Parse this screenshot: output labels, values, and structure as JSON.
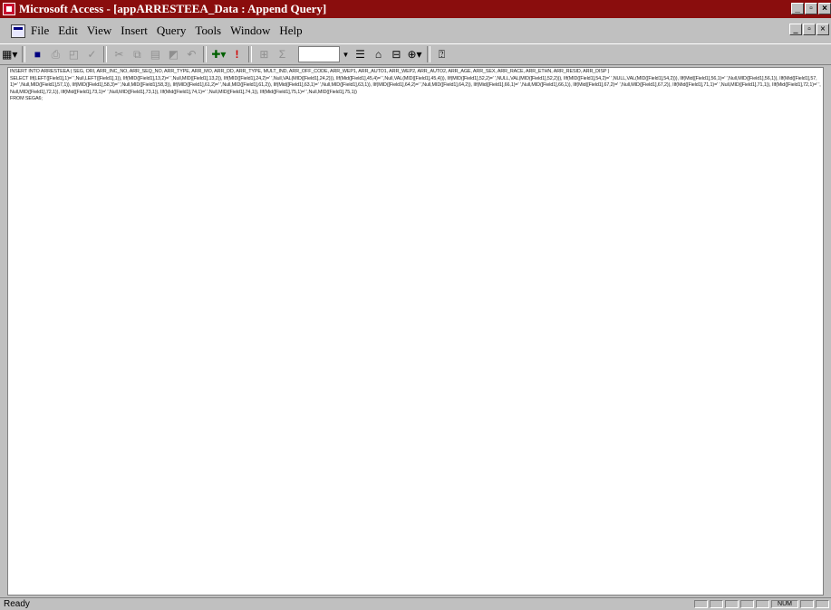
{
  "window": {
    "title": "Microsoft Access - [appARRESTEEA_Data : Append Query]"
  },
  "menu": {
    "items": [
      "File",
      "Edit",
      "View",
      "Insert",
      "Query",
      "Tools",
      "Window",
      "Help"
    ]
  },
  "toolbar": {
    "buttons": [
      {
        "name": "view-icon",
        "glyph": "▦▾"
      },
      {
        "name": "save-icon",
        "glyph": "■"
      },
      {
        "name": "print-icon",
        "glyph": "⎙"
      },
      {
        "name": "print-preview-icon",
        "glyph": "🔍"
      },
      {
        "name": "spelling-icon",
        "glyph": "✓"
      },
      {
        "name": "cut-icon",
        "glyph": "✂"
      },
      {
        "name": "copy-icon",
        "glyph": "⧉"
      },
      {
        "name": "paste-icon",
        "glyph": "📋"
      },
      {
        "name": "format-painter-icon",
        "glyph": "🖌"
      },
      {
        "name": "undo-icon",
        "glyph": "↶"
      },
      {
        "name": "query-type-icon",
        "glyph": "✚▾"
      },
      {
        "name": "run-icon",
        "glyph": "!"
      },
      {
        "name": "show-table-icon",
        "glyph": "⊞"
      },
      {
        "name": "totals-icon",
        "glyph": "Σ"
      },
      {
        "name": "properties-icon",
        "glyph": "☰"
      },
      {
        "name": "build-icon",
        "glyph": "⌂"
      },
      {
        "name": "database-window-icon",
        "glyph": "⊟"
      },
      {
        "name": "new-object-icon",
        "glyph": "⊕▾"
      },
      {
        "name": "help-icon",
        "glyph": "?"
      }
    ]
  },
  "query_text": "INSERT INTO ARRESTEEA ( SEG, ORI, ARR_INC_NO, ARR_SEQ_NO, ARR_TYPE, ARR_MO, ARR_DD, ARR_TYPE, MULT_IND, ARR_OFF_CODE, ARR_WEP1, ARR_AUTO1, ARR_WEP2, ARR_AUTO2, ARR_AGE, ARR_SEX, ARR_RACE, ARR_ETHN, ARR_RESID, ARR_DISP )\nSELECT IIf(LEFT([Field1],1)=' ',Null,LEFT([Field1],1)), IIf(MID([Field1],13,2)=' ',Null,MID([Field1],13,2)), IIf(MID([Field1],24,2)=' ',Null,VAL(MID([Field1],24,2))), IIf(Mid([Field1],45,4)=' ',Null,VAL(MID([Field1],45,4))), IIf(MID([Field1],52,2)=' ',NULL,VAL(MID([Field1],52,2))), IIf(MID([Field1],54,2)=' ',NULL,VAL(MID([Field1],54,2))), IIf(Mid([Field1],56,1)=' ',Null,MID([Field1],56,1)), IIf(Mid([Field1],57,1)=' ',Null,MID([Field1],57,1)), IIf(MID([Field1],58,3)=' ',Null,MID([Field1],58,3)), IIf(MID([Field1],61,2)=' ',Null,MID([Field1],61,2)), IIf(Mid([Field1],63,1)=' ',Null,MID([Field1],63,1)), IIf(MID([Field1],64,2)=' ',Null,MID([Field1],64,2)), IIf(Mid([Field1],66,1)=' ',Null,MID([Field1],66,1)), IIf(Mid([Field1],67,2)=' ',Null,MID([Field1],67,2)), IIf(Mid([Field1],71,1)=' ',Null,MID([Field1],71,1)), IIf(Mid([Field1],72,1)=' ',Null,MID([Field1],72,1)), IIf(Mid([Field1],73,1)=' ',Null,MID([Field1],73,1)), IIf(Mid([Field1],74,1)=' ',Null,MID([Field1],74,1)), IIf(Mid([Field1],75,1)=' ',Null,MID([Field1],75,1))\nFROM SEGA6;",
  "status": {
    "text": "Ready",
    "num_lock": "NUM"
  }
}
